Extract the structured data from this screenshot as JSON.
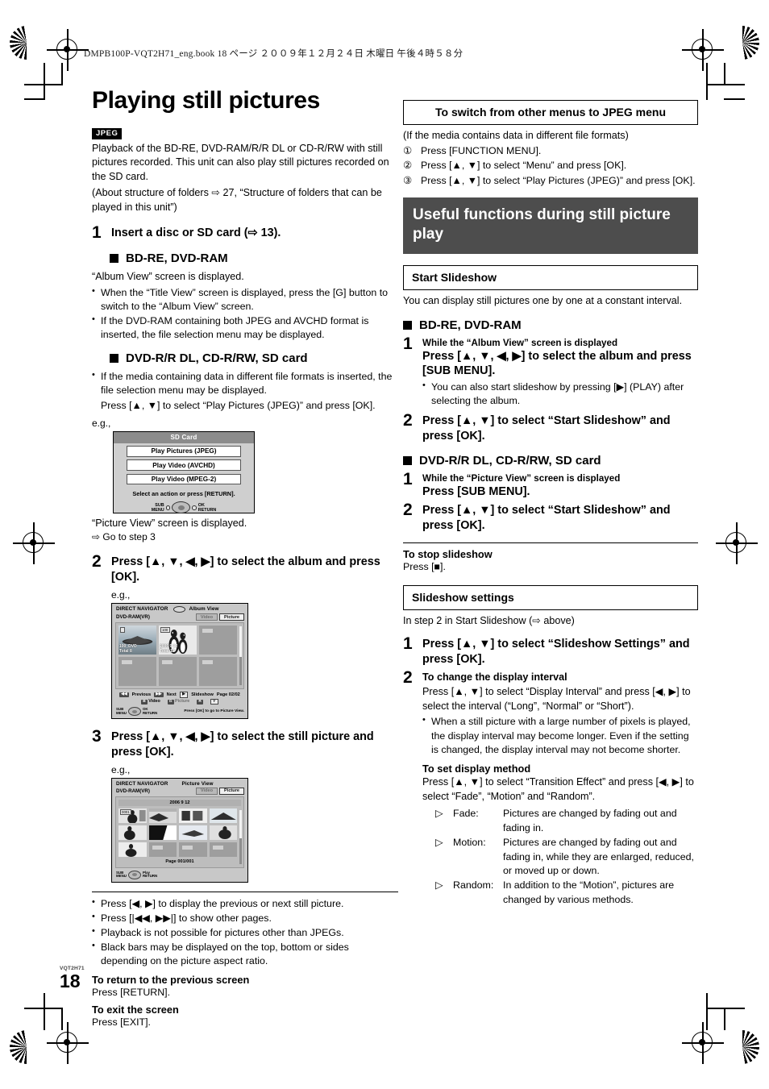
{
  "page": {
    "book_header": "DMPB100P-VQT2H71_eng.book    18 ページ    ２００９年１２月２４日    木曜日    午後４時５８分",
    "page_number": "18",
    "doc_code": "VQT2H71"
  },
  "left": {
    "title": "Playing still pictures",
    "jpeg_tag": "JPEG",
    "intro": [
      "Playback of the BD-RE, DVD-RAM/R/R DL or CD-R/RW with still pictures recorded. This unit can also play still pictures recorded on the SD card.",
      "(About structure of folders ⇨ 27, “Structure of folders that can be played in this unit”)"
    ],
    "step1": {
      "num": "1",
      "head": "Insert a disc or SD card (⇨ 13).",
      "sub1_head": "BD-RE, DVD-RAM",
      "sub1_line": "“Album View” screen is displayed.",
      "sub1_bullets": [
        "When the “Title View” screen is displayed, press the [G] button to switch to the “Album View” screen.",
        "If the DVD-RAM containing both JPEG and AVCHD format is inserted, the file selection menu may be displayed."
      ],
      "sub2_head": "DVD-R/R DL, CD-R/RW, SD card",
      "sub2_bullets": [
        "If the media containing data in different file formats is inserted, the file selection menu may be displayed."
      ],
      "sub2_extra": "Press [▲, ▼] to select “Play Pictures (JPEG)” and press [OK].",
      "eg_label": "e.g.,",
      "after_screen_line1": "“Picture View” screen is displayed.",
      "after_screen_line2": "⇨ Go to step 3"
    },
    "sd_dialog": {
      "title": "SD Card",
      "options": [
        "Play Pictures (JPEG)",
        "Play Video (AVCHD)",
        "Play Video (MPEG-2)"
      ],
      "note": "Select an action or press [RETURN].",
      "remote_left_top": "SUB",
      "remote_left_bottom": "MENU",
      "remote_right_top": "OK",
      "remote_right_bottom": "RETURN"
    },
    "step2": {
      "num": "2",
      "head": "Press [▲, ▼, ◀, ▶] to select the album and press [OK].",
      "eg_label": "e.g.,"
    },
    "album_view": {
      "nav_label": "DIRECT NAVIGATOR",
      "view_label": "Album View",
      "media": "DVD-RAM(VR)",
      "tab_video": "Video",
      "tab_picture": "Picture",
      "thumbs": [
        {
          "tag": "",
          "cap1": "100_DVD",
          "cap2": "Total 8"
        },
        {
          "tag": "100",
          "cap1": "2006  9 12",
          "cap2": "Total 12"
        },
        {
          "tag": "",
          "cap1": "",
          "cap2": ""
        },
        {
          "tag": "",
          "cap1": "",
          "cap2": ""
        },
        {
          "tag": "",
          "cap1": "",
          "cap2": ""
        },
        {
          "tag": "",
          "cap1": "",
          "cap2": ""
        }
      ],
      "bot_prev": "Previous",
      "bot_next": "Next",
      "bot_slideshow": "Slideshow",
      "bot_page": "Page  02/02",
      "key_prev": "◀◀",
      "key_next": "▶▶",
      "key_play": "▶",
      "color_video": "Video",
      "color_picture": "Picture",
      "color_r": "R",
      "color_y": "Y",
      "remote_sub": "SUB",
      "remote_menu": "MENU",
      "remote_ok": "OK",
      "remote_return": "RETURN",
      "hint": "Press [OK] to go to Picture View."
    },
    "step3": {
      "num": "3",
      "head": "Press [▲, ▼, ◀, ▶] to select the still picture and press [OK].",
      "eg_label": "e.g.,"
    },
    "picture_view": {
      "nav_label": "DIRECT NAVIGATOR",
      "view_label": "Picture View",
      "media": "DVD-RAM(VR)",
      "tab_video": "Video",
      "tab_picture": "Picture",
      "date": "2006   9   12",
      "first_thumb_tag": "0001",
      "page": "Page  001/001",
      "remote_sub": "SUB",
      "remote_menu": "MENU",
      "remote_play": "Play",
      "remote_return": "RETURN"
    },
    "end_bullets": [
      "Press [◀, ▶] to display the previous or next still picture.",
      "Press [|◀◀, ▶▶|] to show other pages.",
      "Playback is not possible for pictures other than JPEGs.",
      "Black bars may be displayed on the top, bottom or sides depending on the picture aspect ratio."
    ],
    "to_return_head": "To return to the previous screen",
    "to_return_body": "Press [RETURN].",
    "to_exit_head": "To exit the screen",
    "to_exit_body": "Press [EXIT]."
  },
  "right": {
    "switch_box": {
      "title": "To switch from other menus to JPEG menu",
      "lead": "(If the media contains data in different file formats)",
      "steps": [
        {
          "marker": "①",
          "text": "Press [FUNCTION MENU]."
        },
        {
          "marker": "②",
          "text": "Press [▲, ▼] to select “Menu” and press [OK]."
        },
        {
          "marker": "③",
          "text": "Press [▲, ▼] to select “Play Pictures (JPEG)” and press [OK]."
        }
      ]
    },
    "band_title": "Useful functions during still picture play",
    "start_slideshow": {
      "box_title": "Start Slideshow",
      "lead": "You can display still pictures one by one at a constant interval.",
      "group1_head": "BD-RE, DVD-RAM",
      "g1_step1_num": "1",
      "g1_step1_small": "While the “Album View” screen is displayed",
      "g1_step1_head": "Press [▲, ▼, ◀, ▶] to select the album and press [SUB MENU].",
      "g1_step1_bullet": "You can also start slideshow by pressing [▶] (PLAY) after selecting the album.",
      "g1_step2_num": "2",
      "g1_step2_head": "Press [▲, ▼] to select “Start Slideshow” and press [OK].",
      "group2_head": "DVD-R/R DL, CD-R/RW, SD card",
      "g2_step1_num": "1",
      "g2_step1_small": "While the “Picture View” screen is displayed",
      "g2_step1_head": "Press [SUB MENU].",
      "g2_step2_num": "2",
      "g2_step2_head": "Press [▲, ▼] to select “Start Slideshow” and press [OK].",
      "stop_head": "To stop slideshow",
      "stop_body": "Press [■]."
    },
    "slideshow_settings": {
      "box_title": "Slideshow settings",
      "lead": "In step 2 in Start Slideshow (⇨ above)",
      "step1_num": "1",
      "step1_head": "Press [▲, ▼] to select “Slideshow Settings” and press [OK].",
      "step2_num": "2",
      "step2_head": "To change the display interval",
      "step2_body": "Press [▲, ▼] to select “Display Interval” and press [◀, ▶] to select the interval (“Long”, “Normal” or “Short”).",
      "step2_bullet": "When a still picture with a large number of pixels is played, the display interval may become longer. Even if the setting is changed, the display interval may not become shorter.",
      "method_head": "To set display method",
      "method_body": "Press [▲, ▼] to select “Transition Effect” and press [◀, ▶] to select “Fade”, “Motion” and “Random”.",
      "methods": [
        {
          "marker": "▷",
          "label": "Fade:",
          "text": "Pictures are changed by fading out and fading in."
        },
        {
          "marker": "▷",
          "label": "Motion:",
          "text": "Pictures are changed by fading out and fading in, while they are enlarged, reduced, or moved up or down."
        },
        {
          "marker": "▷",
          "label": "Random:",
          "text": "In addition to the “Motion”, pictures are changed by various methods."
        }
      ]
    }
  }
}
